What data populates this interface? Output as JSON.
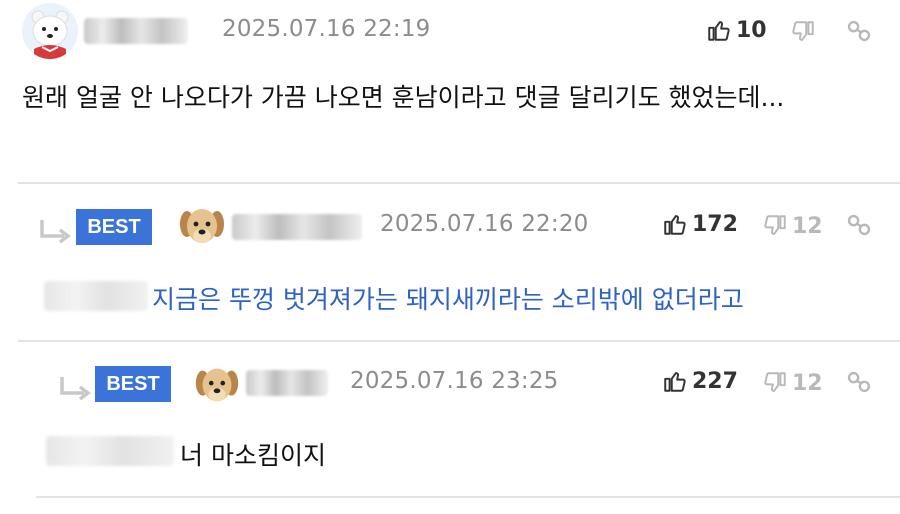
{
  "comments": [
    {
      "timestamp": "2025.07.16 22:19",
      "likes": "10",
      "dislikes": "",
      "text": "원래 얼굴 안 나오다가 가끔 나오면 훈남이라고 댓글 달리기도 했었는데..."
    },
    {
      "badge": "BEST",
      "timestamp": "2025.07.16 22:20",
      "likes": "172",
      "dislikes": "12",
      "text": "지금은 뚜껑 벗겨져가는 돼지새끼라는 소리밖에 없더라고"
    },
    {
      "badge": "BEST",
      "timestamp": "2025.07.16 23:25",
      "likes": "227",
      "dislikes": "12",
      "text": "너 마소킴이지"
    }
  ],
  "icons": {
    "like": "thumbs-up-icon",
    "dislike": "thumbs-down-icon",
    "link": "link-icon",
    "reply": "reply-arrow-icon"
  },
  "colors": {
    "badge": "#3b73d8",
    "mention_text": "#2e63c3",
    "timestamp": "#8c8c8c"
  }
}
